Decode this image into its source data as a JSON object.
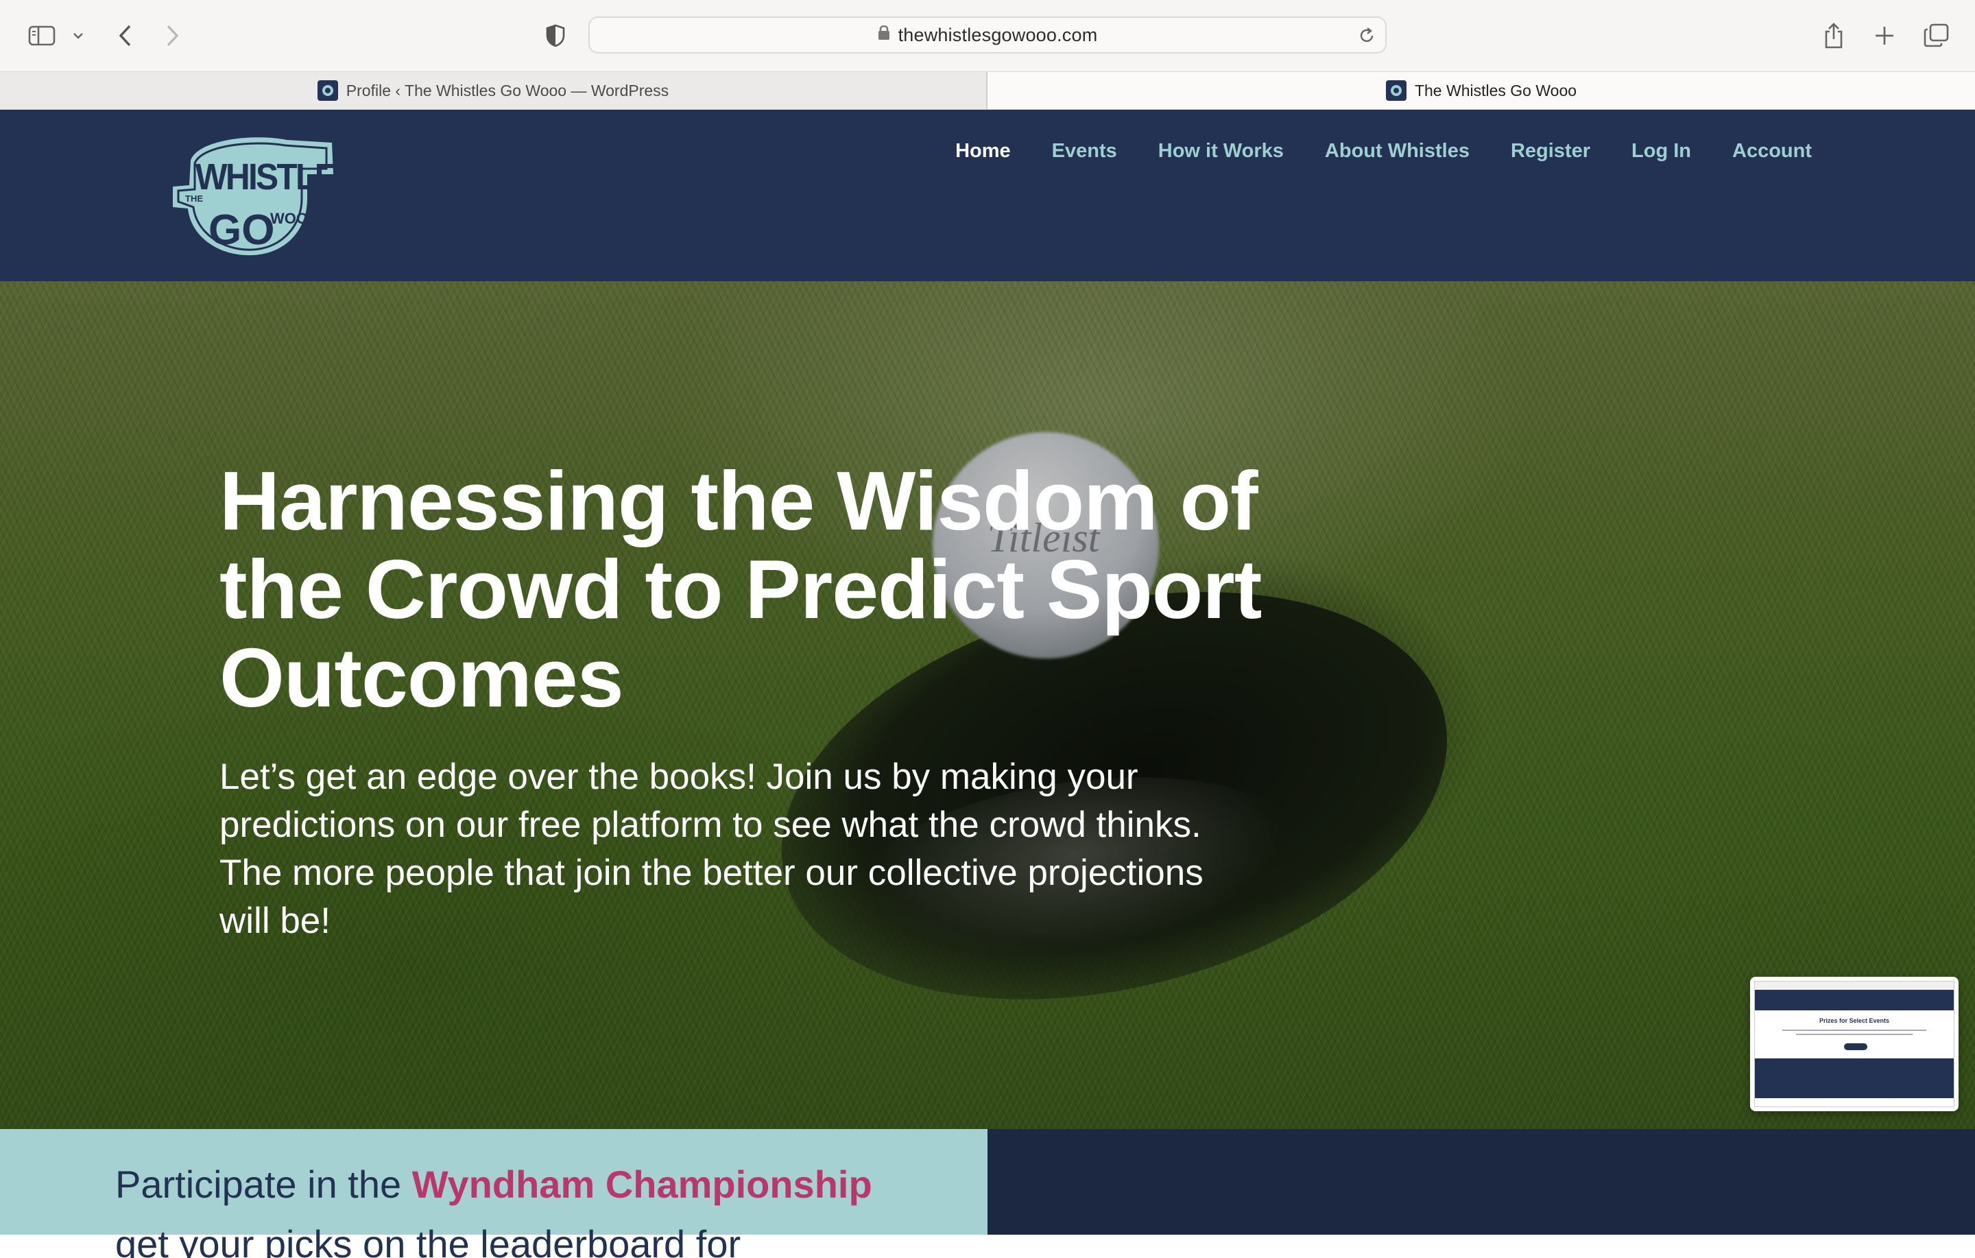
{
  "browser": {
    "url": "thewhistlesgowooo.com",
    "tabs": [
      {
        "title": "Profile ‹ The Whistles Go Wooo — WordPress",
        "active": false
      },
      {
        "title": "The Whistles Go Wooo",
        "active": true
      }
    ],
    "icons": [
      "sidebar-icon",
      "chevron-down-icon",
      "back-icon",
      "forward-icon",
      "privacy-shield-icon",
      "lock-icon",
      "reload-icon",
      "share-icon",
      "new-tab-icon",
      "tab-overview-icon"
    ]
  },
  "site": {
    "logo_alt": "The Whistles Go Wooo logo",
    "nav": [
      {
        "label": "Home",
        "active": true
      },
      {
        "label": "Events",
        "active": false
      },
      {
        "label": "How it Works",
        "active": false
      },
      {
        "label": "About Whistles",
        "active": false
      },
      {
        "label": "Register",
        "active": false
      },
      {
        "label": "Log In",
        "active": false
      },
      {
        "label": "Account",
        "active": false
      }
    ]
  },
  "hero": {
    "title": "Harnessing the Wisdom of the Crowd to Predict Sport Outcomes",
    "text": "Let’s get an edge over the books! Join us by making your predictions on our free platform to see what the crowd thinks. The more people that join the better our collective projections will be!"
  },
  "participate": {
    "prefix": "Participate in the ",
    "event": "Wyndham Championship",
    "cut_text": "get your picks on the leaderboard for"
  },
  "thumbnail": {
    "title": "Prizes for Select Events"
  },
  "colors": {
    "nav_bg": "#233252",
    "nav_link": "#9ecfd1",
    "accent_pink": "#b9376b",
    "panel_teal": "#a6d1d2",
    "panel_navy": "#1c2741"
  }
}
